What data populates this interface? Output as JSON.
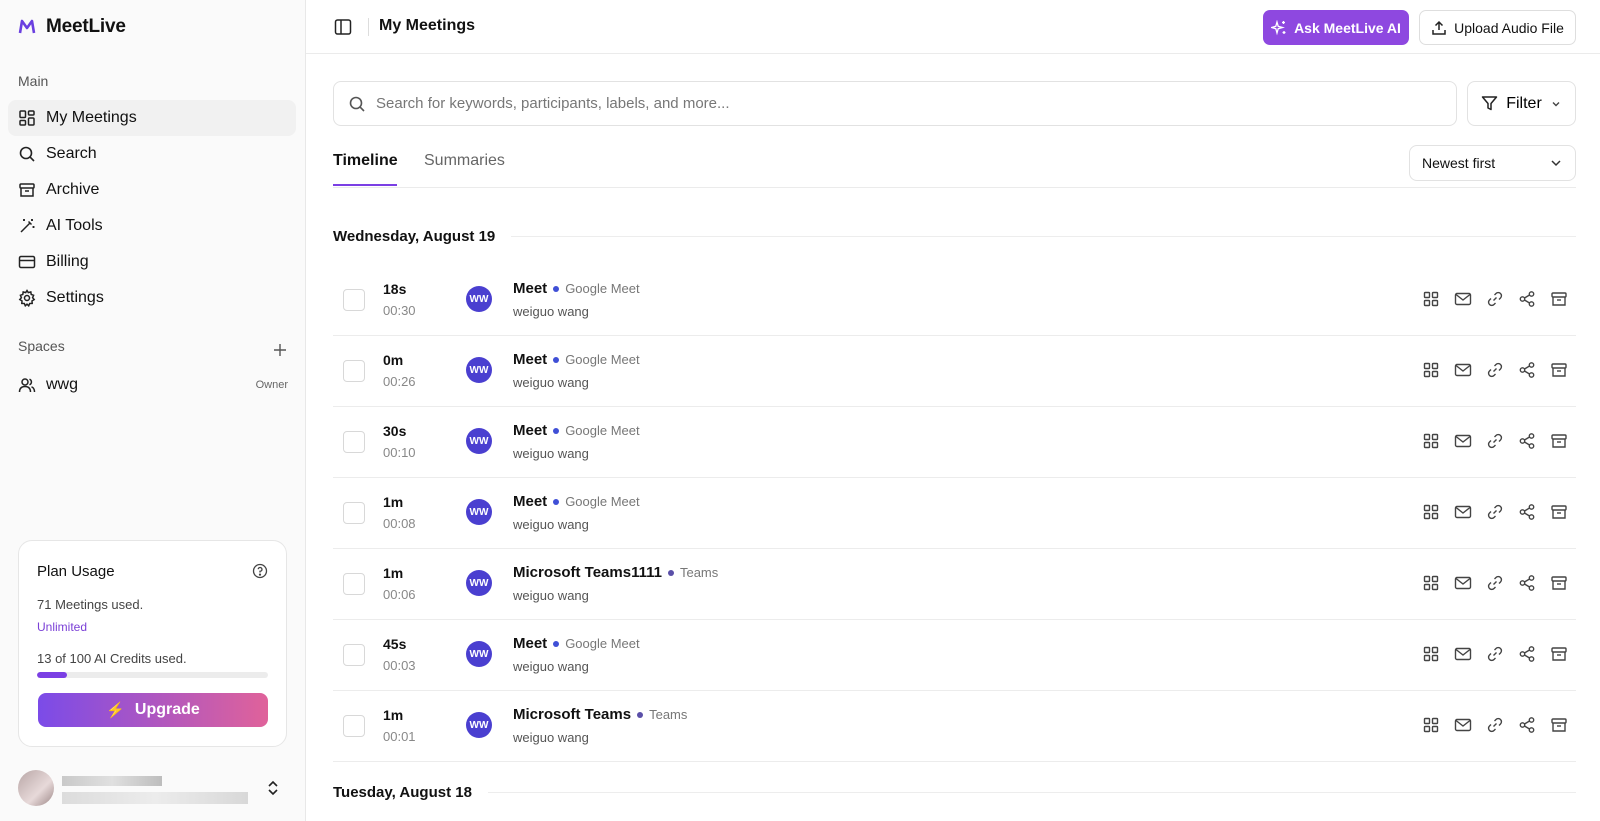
{
  "app": {
    "name": "MeetLive"
  },
  "sidebar": {
    "main_label": "Main",
    "items": [
      {
        "label": "My Meetings",
        "icon": "grid-icon",
        "active": true
      },
      {
        "label": "Search",
        "icon": "search-icon"
      },
      {
        "label": "Archive",
        "icon": "archive-icon"
      },
      {
        "label": "AI Tools",
        "icon": "magic-wand-icon"
      },
      {
        "label": "Billing",
        "icon": "credit-card-icon"
      },
      {
        "label": "Settings",
        "icon": "gear-icon"
      }
    ],
    "spaces_label": "Spaces",
    "spaces": [
      {
        "name": "wwg",
        "role": "Owner"
      }
    ]
  },
  "plan": {
    "title": "Plan Usage",
    "meetings_used": "71 Meetings used.",
    "plan_type": "Unlimited",
    "credits_used": "13 of 100 AI Credits used.",
    "credits_fraction": 0.13,
    "upgrade_label": "Upgrade"
  },
  "header": {
    "title": "My Meetings",
    "ask_label": "Ask MeetLive AI",
    "upload_label": "Upload Audio File"
  },
  "search": {
    "placeholder": "Search for keywords, participants, labels, and more..."
  },
  "filter": {
    "label": "Filter"
  },
  "tabs": [
    {
      "label": "Timeline",
      "active": true
    },
    {
      "label": "Summaries"
    }
  ],
  "sort": {
    "value": "Newest first"
  },
  "groups": [
    {
      "date": "Wednesday, August 19",
      "meetings": [
        {
          "duration": "18s",
          "time": "00:30",
          "initials": "WW",
          "title": "Meet",
          "platform": "Google Meet",
          "owner": "weiguo wang"
        },
        {
          "duration": "0m",
          "time": "00:26",
          "initials": "WW",
          "title": "Meet",
          "platform": "Google Meet",
          "owner": "weiguo wang"
        },
        {
          "duration": "30s",
          "time": "00:10",
          "initials": "WW",
          "title": "Meet",
          "platform": "Google Meet",
          "owner": "weiguo wang"
        },
        {
          "duration": "1m",
          "time": "00:08",
          "initials": "WW",
          "title": "Meet",
          "platform": "Google Meet",
          "owner": "weiguo wang"
        },
        {
          "duration": "1m",
          "time": "00:06",
          "initials": "WW",
          "title": "Microsoft Teams1111",
          "platform": "Teams",
          "owner": "weiguo wang"
        },
        {
          "duration": "45s",
          "time": "00:03",
          "initials": "WW",
          "title": "Meet",
          "platform": "Google Meet",
          "owner": "weiguo wang"
        },
        {
          "duration": "1m",
          "time": "00:01",
          "initials": "WW",
          "title": "Microsoft Teams",
          "platform": "Teams",
          "owner": "weiguo wang"
        }
      ]
    },
    {
      "date": "Tuesday, August 18",
      "meetings": []
    }
  ],
  "colors": {
    "accent": "#7b3fe4",
    "ask_button": "#8e48e0",
    "avatar": "#4a3fd0",
    "upgrade_gradient_start": "#7b4be8",
    "upgrade_gradient_end": "#e0629a"
  }
}
